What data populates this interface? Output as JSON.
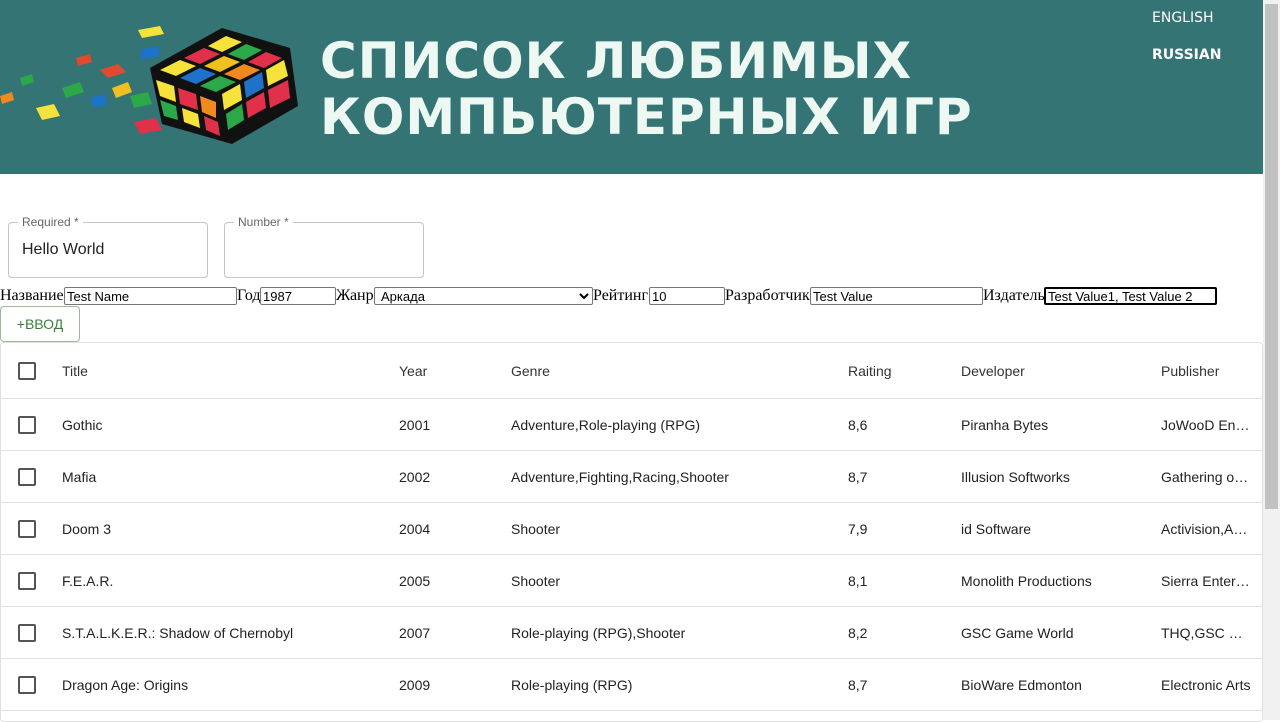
{
  "header": {
    "title_line1": "СПИСОК ЛЮБИМЫХ",
    "title_line2": "КОМПЬЮТЕРНЫХ ИГР",
    "lang_english": "ENGLISH",
    "lang_russian": "RUSSIAN",
    "background_color": "#347474"
  },
  "fields": {
    "required_label": "Required *",
    "required_value": "Hello World",
    "number_label": "Number *",
    "number_value": ""
  },
  "form": {
    "name_label": "Название",
    "name_value": "Test Name",
    "year_label": "Год",
    "year_value": "1987",
    "genre_label": "Жанр",
    "genre_value": "Аркада",
    "rating_label": "Рейтинг",
    "rating_value": "10",
    "developer_label": "Разработчик",
    "developer_value": "Test Value",
    "publisher_label": "Издатель",
    "publisher_value": "Test Value1, Test Value 2",
    "add_button": "+ВВОД"
  },
  "table": {
    "columns": [
      "Title",
      "Year",
      "Genre",
      "Raiting",
      "Developer",
      "Publisher"
    ],
    "rows": [
      {
        "title": "Gothic",
        "year": "2001",
        "genre": "Adventure,Role-playing (RPG)",
        "rating": "8,6",
        "developer": "Piranha Bytes",
        "publisher": "JoWooD En…"
      },
      {
        "title": "Mafia",
        "year": "2002",
        "genre": "Adventure,Fighting,Racing,Shooter",
        "rating": "8,7",
        "developer": "Illusion Softworks",
        "publisher": "Gathering o…"
      },
      {
        "title": "Doom 3",
        "year": "2004",
        "genre": "Shooter",
        "rating": "7,9",
        "developer": "id Software",
        "publisher": "Activision,A…"
      },
      {
        "title": "F.E.A.R.",
        "year": "2005",
        "genre": "Shooter",
        "rating": "8,1",
        "developer": "Monolith Productions",
        "publisher": "Sierra Enter…"
      },
      {
        "title": "S.T.A.L.K.E.R.: Shadow of Chernobyl",
        "year": "2007",
        "genre": "Role-playing (RPG),Shooter",
        "rating": "8,2",
        "developer": "GSC Game World",
        "publisher": "THQ,GSC …"
      },
      {
        "title": "Dragon Age: Origins",
        "year": "2009",
        "genre": "Role-playing (RPG)",
        "rating": "8,7",
        "developer": "BioWare Edmonton",
        "publisher": "Electronic Arts"
      }
    ]
  }
}
